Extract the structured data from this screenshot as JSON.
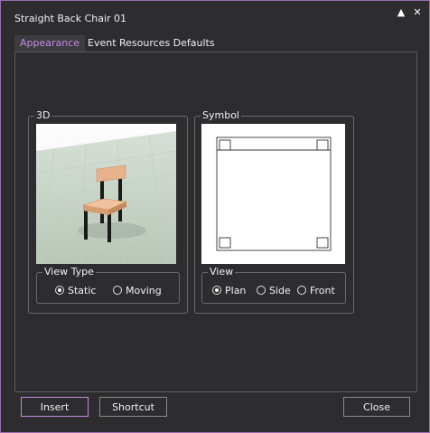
{
  "window": {
    "title": "Straight Back Chair 01",
    "collapse_glyph": "▲",
    "close_glyph": "✕"
  },
  "tabs": [
    {
      "label": "Appearance",
      "active": true
    },
    {
      "label": "Event Resources Defaults",
      "active": false
    }
  ],
  "groups": {
    "three_d": {
      "label": "3D",
      "view_type": {
        "label": "View Type",
        "options": [
          {
            "label": "Static",
            "checked": true
          },
          {
            "label": "Moving",
            "checked": false
          }
        ]
      }
    },
    "symbol": {
      "label": "Symbol",
      "view": {
        "label": "View",
        "options": [
          {
            "label": "Plan",
            "checked": true
          },
          {
            "label": "Side",
            "checked": false
          },
          {
            "label": "Front",
            "checked": false
          }
        ]
      }
    }
  },
  "buttons": {
    "insert": "Insert",
    "shortcut": "Shortcut",
    "close": "Close"
  },
  "colors": {
    "background": "#2d2d30",
    "accent": "#c58be0",
    "chair_wood": "#e8b38a",
    "chair_legs": "#1a1a1a",
    "floor": "#c9d6c8"
  }
}
